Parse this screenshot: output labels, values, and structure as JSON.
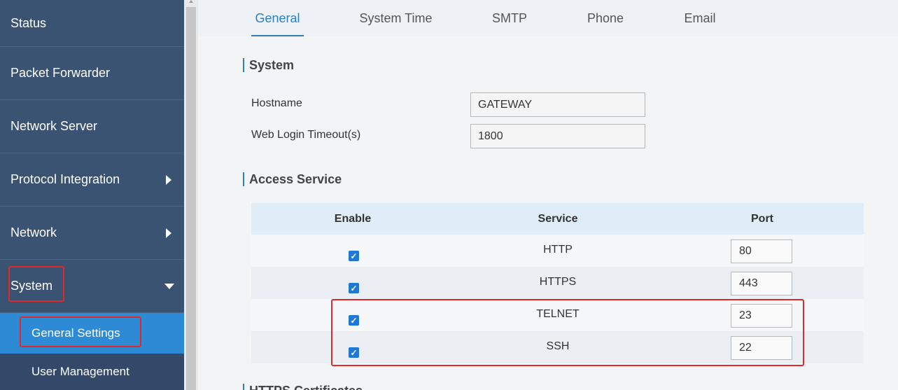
{
  "sidebar": {
    "items": [
      {
        "label": "Status",
        "has_arrow": false
      },
      {
        "label": "Packet Forwarder",
        "has_arrow": false
      },
      {
        "label": "Network Server",
        "has_arrow": false
      },
      {
        "label": "Protocol Integration",
        "has_arrow": true
      },
      {
        "label": "Network",
        "has_arrow": true
      },
      {
        "label": "System",
        "expanded": true
      }
    ],
    "sub_items": [
      {
        "label": "General Settings",
        "active": true
      },
      {
        "label": "User Management",
        "active": false
      }
    ]
  },
  "tabs": [
    {
      "label": "General",
      "active": true
    },
    {
      "label": "System Time",
      "active": false
    },
    {
      "label": "SMTP",
      "active": false
    },
    {
      "label": "Phone",
      "active": false
    },
    {
      "label": "Email",
      "active": false
    }
  ],
  "system_section": {
    "title": "System",
    "hostname_label": "Hostname",
    "hostname_value": "GATEWAY",
    "timeout_label": "Web Login Timeout(s)",
    "timeout_value": "1800"
  },
  "access_service": {
    "title": "Access Service",
    "headers": {
      "enable": "Enable",
      "service": "Service",
      "port": "Port"
    },
    "rows": [
      {
        "enabled": true,
        "service": "HTTP",
        "port": "80"
      },
      {
        "enabled": true,
        "service": "HTTPS",
        "port": "443"
      },
      {
        "enabled": true,
        "service": "TELNET",
        "port": "23"
      },
      {
        "enabled": true,
        "service": "SSH",
        "port": "22"
      }
    ]
  },
  "next_section_title": "HTTPS Certificates",
  "colors": {
    "sidebar_bg": "#3a5372",
    "active_blue": "#2d8ad4",
    "accent": "#2d7fc1",
    "highlight_red": "#e02a2a"
  }
}
